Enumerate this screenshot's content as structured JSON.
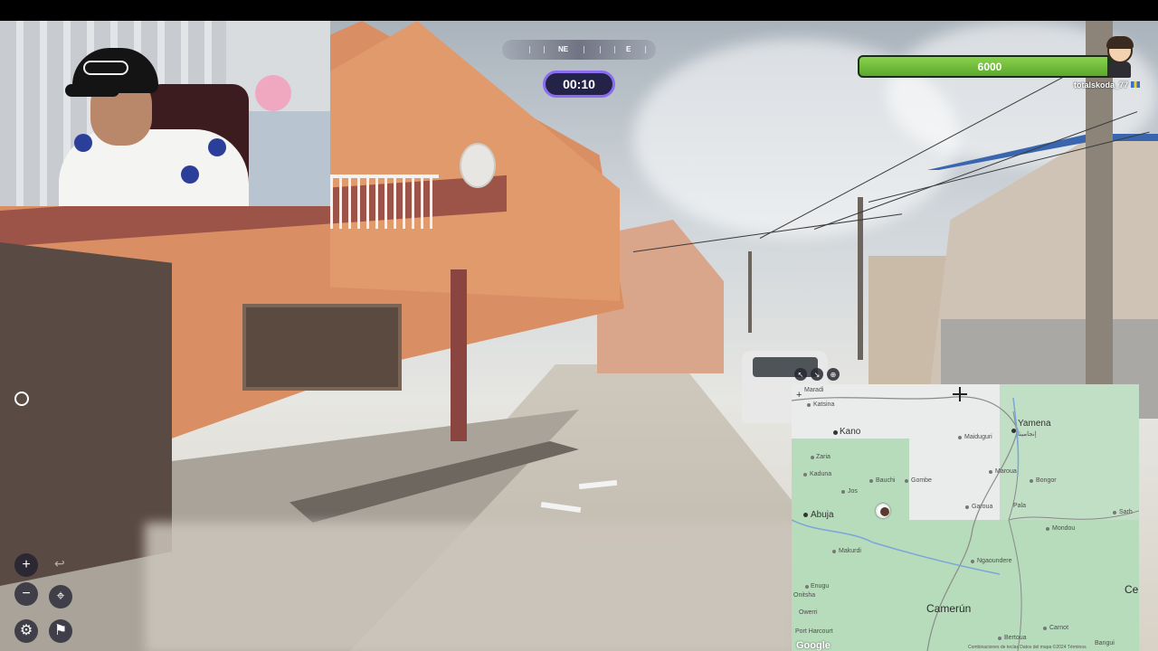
{
  "hud": {
    "timer": "00:10",
    "health_value": "6000",
    "health_fraction": 0.95,
    "player_name": "totalskoda_77",
    "compass": {
      "labels": [
        "NE",
        "E"
      ]
    }
  },
  "controls": {
    "zoom_in": "+",
    "zoom_out": "−",
    "undo": "↩",
    "return_to_start": "⌖",
    "settings": "⚙",
    "flag": "⚑"
  },
  "map": {
    "tools": [
      "↖",
      "↘",
      "⊕"
    ],
    "labels": {
      "maradi": "Maradi",
      "katsina": "Katsina",
      "kano": "Kano",
      "zaria": "Zaria",
      "kaduna": "Kaduna",
      "bauchi": "Bauchi",
      "gombe": "Gombe",
      "jos": "Jos",
      "abuja": "Abuja",
      "makurdi": "Makurdi",
      "enugu": "Enugu",
      "onitsha": "Onitsha",
      "owerri": "Owerri",
      "port_harcourt": "Port Harcourt",
      "maiduguri": "Maiduguri",
      "yamena": "Yamena",
      "yamena_ar": "إنجامينا",
      "maroua": "Maroua",
      "bongor": "Bongor",
      "garoua": "Garoua",
      "pala": "Pala",
      "mondou": "Mondou",
      "sarh": "Sarh",
      "ngaoundere": "Ngaoundere",
      "camerun": "Camerún",
      "bertoua": "Bertoua",
      "carnot": "Carnot",
      "bangui": "Bangui",
      "ce": "Ce"
    },
    "google": "Google",
    "attribution": "Combinaciones de teclas   Datos del mapa ©2024   Términos"
  }
}
